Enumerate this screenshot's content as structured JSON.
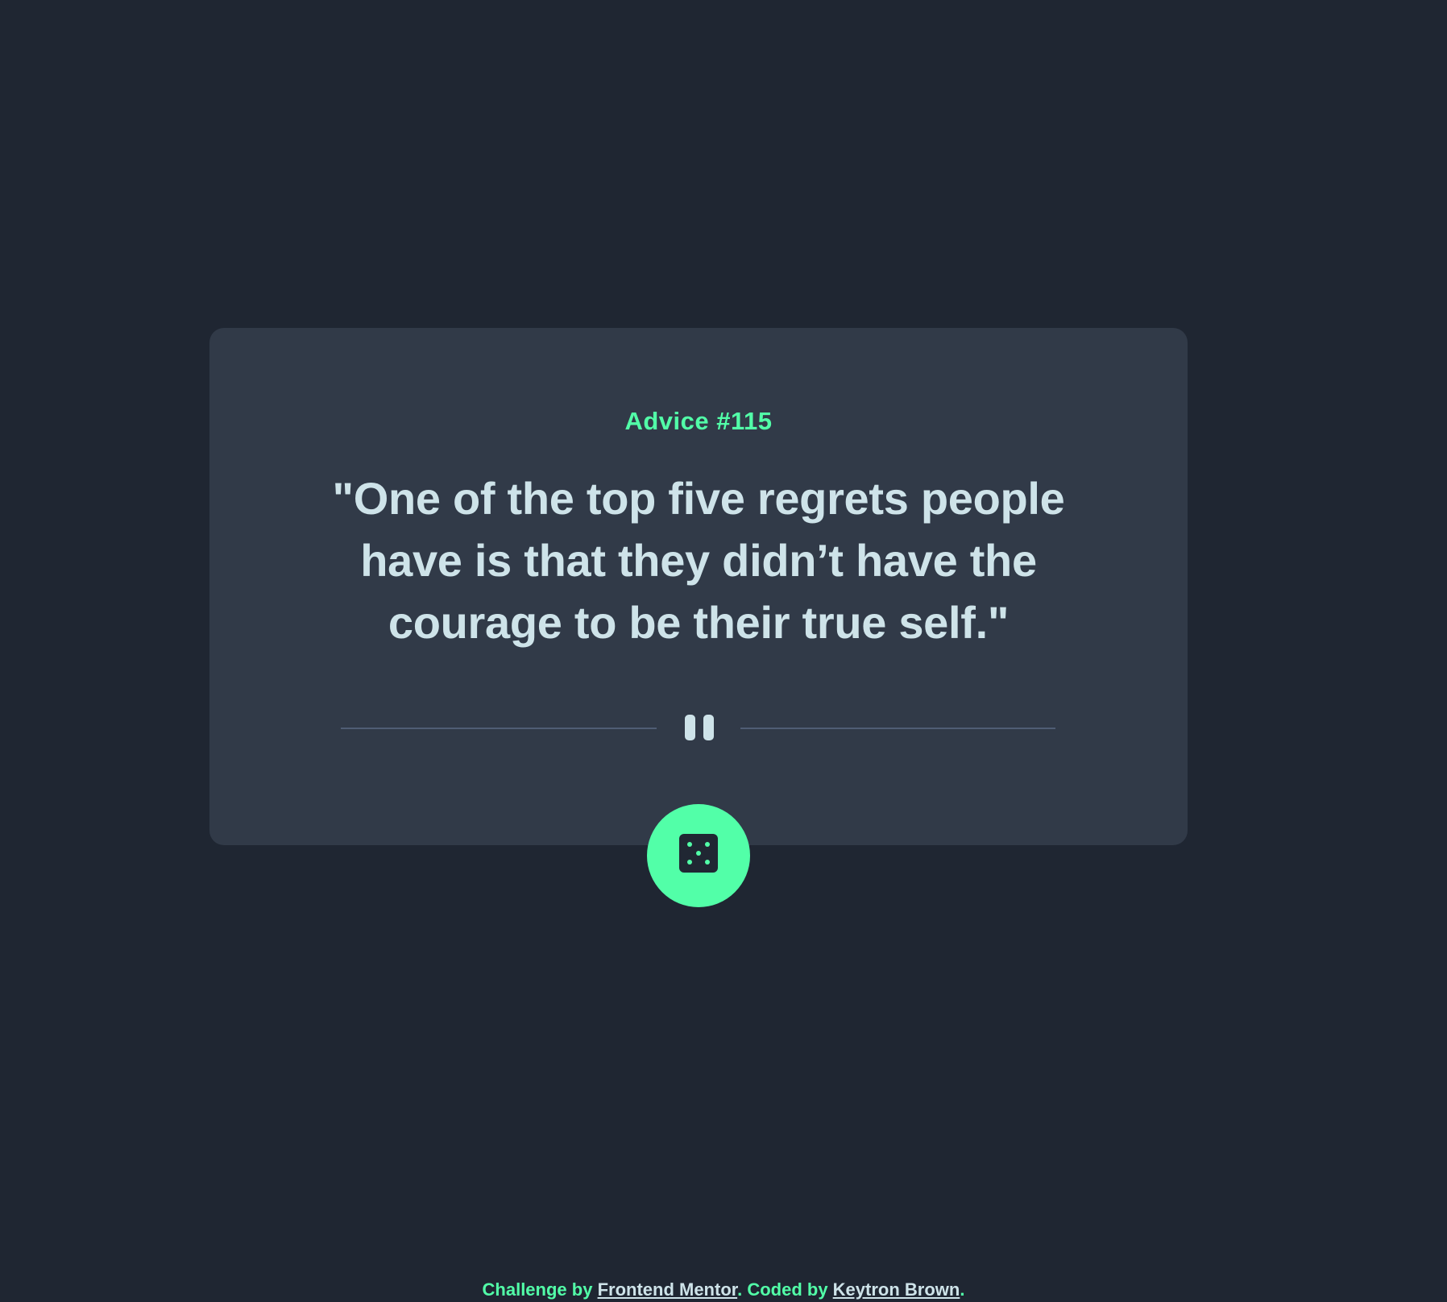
{
  "advice": {
    "label": "Advice #115",
    "quote": "\"One of the top five regrets people have is that they didn’t have the courage to be their true self.\""
  },
  "icons": {
    "divider": "pause-icon",
    "button": "dice-icon"
  },
  "footer": {
    "prefix": "Challenge by ",
    "challenge_link": "Frontend Mentor",
    "middle": ". Coded by ",
    "author_link": "Keytron Brown",
    "suffix": "."
  },
  "colors": {
    "background": "#1f2632",
    "card": "#313a48",
    "accent": "#52ffa8",
    "text": "#cee3e9",
    "divider": "#4f5d74"
  }
}
